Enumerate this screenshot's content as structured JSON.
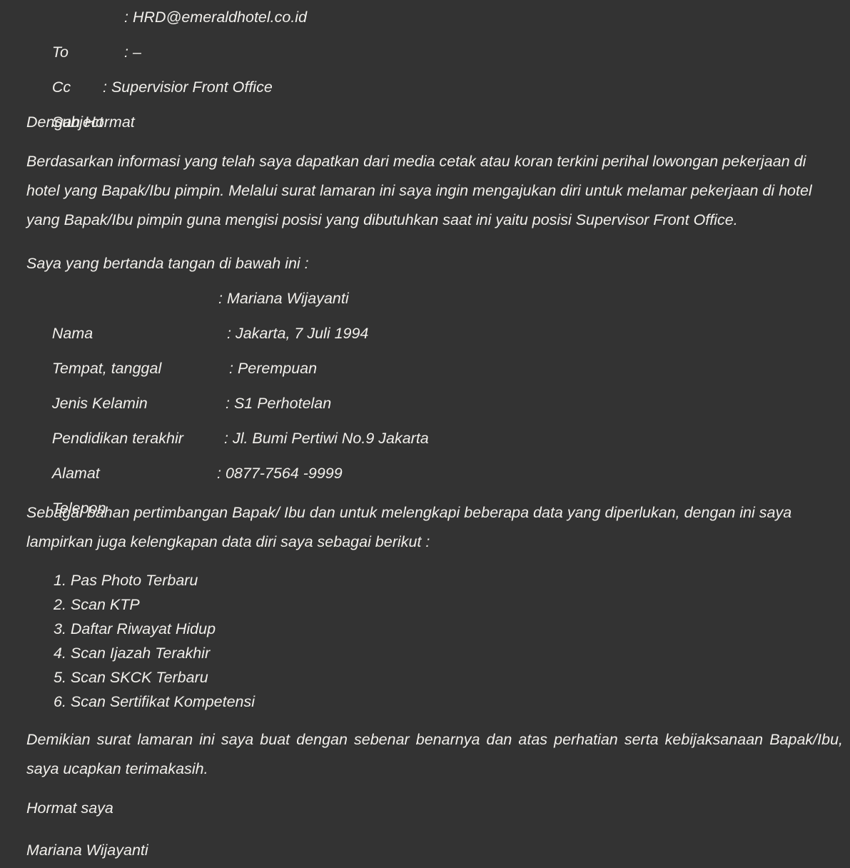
{
  "document": {
    "type": "job-application-letter",
    "language": "id",
    "background_color": "#333333",
    "text_color": "#f2f0ec"
  },
  "header": {
    "rows": [
      {
        "label": "To",
        "value": ": HRD@emeraldhotel.co.id"
      },
      {
        "label": "Cc",
        "value": ": –"
      },
      {
        "label": "Subject",
        "value": ": Supervisior Front Office"
      }
    ]
  },
  "salutation": "Dengan Hormat",
  "intro_paragraph": "Berdasarkan informasi yang telah saya dapatkan dari media cetak atau koran terkini perihal lowongan pekerjaan di hotel yang Bapak/Ibu pimpin. Melalui surat lamaran ini saya ingin mengajukan diri untuk melamar pekerjaan di hotel yang Bapak/Ibu pimpin guna mengisi posisi yang dibutuhkan saat ini yaitu posisi Supervisor Front Office.",
  "details_intro": "Saya yang bertanda tangan di bawah ini :",
  "details": [
    {
      "label": "Nama",
      "value": ": Mariana Wijayanti"
    },
    {
      "label": "Tempat, tanggal",
      "value": ": Jakarta, 7 Juli 1994"
    },
    {
      "label": "Jenis Kelamin",
      "value": ": Perempuan"
    },
    {
      "label": "Pendidikan terakhir",
      "value": ": S1 Perhotelan"
    },
    {
      "label": "Alamat",
      "value": ": Jl. Bumi Pertiwi No.9 Jakarta"
    },
    {
      "label": "Telepon",
      "value": ": 0877-7564 -9999"
    }
  ],
  "attachments_intro": "Sebagai bahan pertimbangan Bapak/ Ibu dan untuk melengkapi beberapa data yang diperlukan, dengan ini saya lampirkan juga kelengkapan data diri saya sebagai berikut :",
  "attachments": [
    "1. Pas Photo Terbaru",
    "2. Scan KTP",
    "3. Daftar Riwayat Hidup",
    "4. Scan Ijazah Terakhir",
    "5. Scan SKCK Terbaru",
    "6. Scan Sertifikat Kompetensi"
  ],
  "closing_paragraph": "Demikian surat lamaran ini saya buat dengan sebenar benarnya dan atas perhatian serta kebijaksanaan Bapak/Ibu, saya ucapkan terimakasih.",
  "signoff": "Hormat saya",
  "signature_name": "Mariana Wijayanti"
}
